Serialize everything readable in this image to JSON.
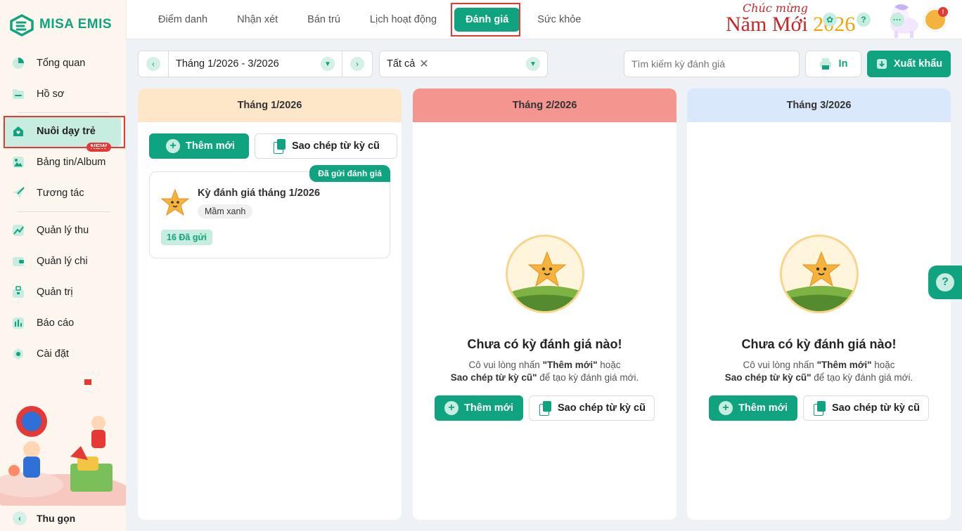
{
  "app": {
    "logo_text": "MISA EMIS"
  },
  "sidebar": {
    "items": [
      {
        "label": "Tổng quan",
        "icon": "pie-icon"
      },
      {
        "label": "Hồ sơ",
        "icon": "folder-icon"
      },
      {
        "label": "Nuôi dạy trẻ",
        "icon": "heart-home-icon",
        "badge": "NEW"
      },
      {
        "label": "Bảng tin/Album",
        "icon": "image-icon"
      },
      {
        "label": "Tương tác",
        "icon": "send-icon"
      },
      {
        "label": "Quản lý thu",
        "icon": "chart-up-icon"
      },
      {
        "label": "Quản lý chi",
        "icon": "wallet-icon"
      },
      {
        "label": "Quản trị",
        "icon": "briefcase-icon"
      },
      {
        "label": "Báo cáo",
        "icon": "bar-chart-icon"
      },
      {
        "label": "Cài đặt",
        "icon": "gear-icon"
      }
    ],
    "collapse_label": "Thu gọn"
  },
  "topbar": {
    "tabs": [
      "Điểm danh",
      "Nhận xét",
      "Bán trú",
      "Lịch hoạt động",
      "Đánh giá",
      "Sức khỏe"
    ],
    "active_tab": "Đánh giá",
    "banner_line1": "Chúc mừng",
    "banner_line2": "Năm Mới",
    "banner_year": "2026",
    "notification_count": "!"
  },
  "toolbar": {
    "period_value": "Tháng 1/2026 - 3/2026",
    "filter_chip": "Tất cả",
    "search_placeholder": "Tìm kiếm kỳ đánh giá",
    "print_label": "In",
    "export_label": "Xuất khẩu"
  },
  "columns": [
    {
      "title": "Tháng 1/2026",
      "add_label": "Thêm mới",
      "copy_label": "Sao chép từ kỳ cũ",
      "card": {
        "badge": "Đã gửi đánh giá",
        "title": "Kỳ đánh giá tháng 1/2026",
        "tag": "Mầm xanh",
        "sent": "16 Đã gửi"
      }
    },
    {
      "title": "Tháng 2/2026",
      "empty_title": "Chưa có kỳ đánh giá nào!",
      "empty_desc_1": "Cô vui lòng nhấn ",
      "empty_desc_bold_1": "\"Thêm mới\"",
      "empty_desc_2": " hoặc",
      "empty_desc_bold_2": "Sao chép từ kỳ cũ\"",
      "empty_desc_3": " để tạo kỳ đánh giá mới.",
      "add_label": "Thêm mới",
      "copy_label": "Sao chép từ kỳ cũ"
    },
    {
      "title": "Tháng 3/2026",
      "empty_title": "Chưa có kỳ đánh giá nào!",
      "empty_desc_1": "Cô vui lòng nhấn ",
      "empty_desc_bold_1": "\"Thêm mới\"",
      "empty_desc_2": " hoặc",
      "empty_desc_bold_2": "Sao chép từ kỳ cũ\"",
      "empty_desc_3": " để tạo kỳ đánh giá mới.",
      "add_label": "Thêm mới",
      "copy_label": "Sao chép từ kỳ cũ"
    }
  ],
  "colors": {
    "brand": "#10a37f",
    "col1_head": "#fde7c8",
    "col2_head": "#f4958f",
    "col3_head": "#d9e9fb",
    "highlight": "#e53935"
  }
}
